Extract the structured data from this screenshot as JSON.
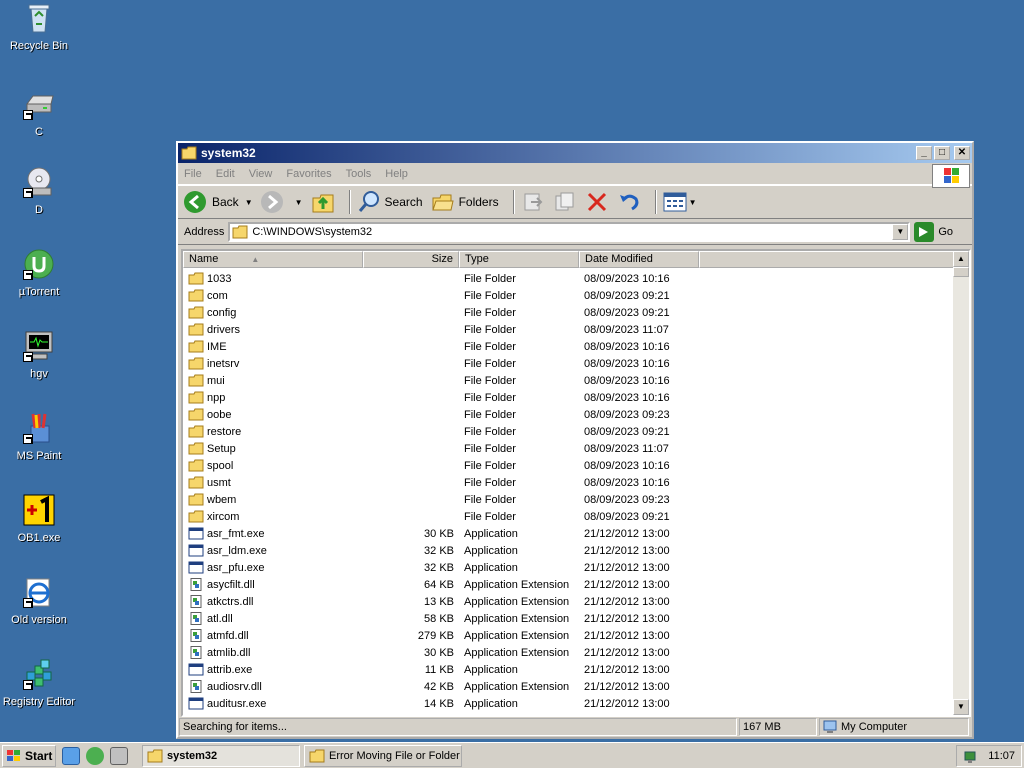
{
  "desktop": {
    "icons": [
      {
        "label": "Recycle Bin",
        "icon": "recycle-bin-icon"
      },
      {
        "label": "C",
        "icon": "drive-icon"
      },
      {
        "label": "D",
        "icon": "cd-drive-icon"
      },
      {
        "label": "µTorrent",
        "icon": "utorrent-icon"
      },
      {
        "label": "hgv",
        "icon": "monitor-icon"
      },
      {
        "label": "MS Paint",
        "icon": "paint-icon"
      },
      {
        "label": "OB1.exe",
        "icon": "ob1-icon"
      },
      {
        "label": "Old version",
        "icon": "internet-explorer-icon"
      },
      {
        "label": "Registry Editor",
        "icon": "registry-editor-icon"
      }
    ]
  },
  "window": {
    "title": "system32",
    "menu": [
      "File",
      "Edit",
      "View",
      "Favorites",
      "Tools",
      "Help"
    ],
    "toolbar": {
      "back_label": "Back",
      "search_label": "Search",
      "folders_label": "Folders"
    },
    "address": {
      "label": "Address",
      "value": "C:\\WINDOWS\\system32",
      "go_label": "Go"
    },
    "columns": {
      "name": "Name",
      "size": "Size",
      "type": "Type",
      "date": "Date Modified"
    },
    "files": [
      {
        "name": "1033",
        "size": "",
        "type": "File Folder",
        "date": "08/09/2023 10:16",
        "kind": "folder"
      },
      {
        "name": "com",
        "size": "",
        "type": "File Folder",
        "date": "08/09/2023 09:21",
        "kind": "folder"
      },
      {
        "name": "config",
        "size": "",
        "type": "File Folder",
        "date": "08/09/2023 09:21",
        "kind": "folder"
      },
      {
        "name": "drivers",
        "size": "",
        "type": "File Folder",
        "date": "08/09/2023 11:07",
        "kind": "folder"
      },
      {
        "name": "IME",
        "size": "",
        "type": "File Folder",
        "date": "08/09/2023 10:16",
        "kind": "folder"
      },
      {
        "name": "inetsrv",
        "size": "",
        "type": "File Folder",
        "date": "08/09/2023 10:16",
        "kind": "folder"
      },
      {
        "name": "mui",
        "size": "",
        "type": "File Folder",
        "date": "08/09/2023 10:16",
        "kind": "folder"
      },
      {
        "name": "npp",
        "size": "",
        "type": "File Folder",
        "date": "08/09/2023 10:16",
        "kind": "folder"
      },
      {
        "name": "oobe",
        "size": "",
        "type": "File Folder",
        "date": "08/09/2023 09:23",
        "kind": "folder"
      },
      {
        "name": "restore",
        "size": "",
        "type": "File Folder",
        "date": "08/09/2023 09:21",
        "kind": "folder"
      },
      {
        "name": "Setup",
        "size": "",
        "type": "File Folder",
        "date": "08/09/2023 11:07",
        "kind": "folder"
      },
      {
        "name": "spool",
        "size": "",
        "type": "File Folder",
        "date": "08/09/2023 10:16",
        "kind": "folder"
      },
      {
        "name": "usmt",
        "size": "",
        "type": "File Folder",
        "date": "08/09/2023 10:16",
        "kind": "folder"
      },
      {
        "name": "wbem",
        "size": "",
        "type": "File Folder",
        "date": "08/09/2023 09:23",
        "kind": "folder"
      },
      {
        "name": "xircom",
        "size": "",
        "type": "File Folder",
        "date": "08/09/2023 09:21",
        "kind": "folder"
      },
      {
        "name": "asr_fmt.exe",
        "size": "30 KB",
        "type": "Application",
        "date": "21/12/2012 13:00",
        "kind": "exe"
      },
      {
        "name": "asr_ldm.exe",
        "size": "32 KB",
        "type": "Application",
        "date": "21/12/2012 13:00",
        "kind": "exe"
      },
      {
        "name": "asr_pfu.exe",
        "size": "32 KB",
        "type": "Application",
        "date": "21/12/2012 13:00",
        "kind": "exe"
      },
      {
        "name": "asycfilt.dll",
        "size": "64 KB",
        "type": "Application Extension",
        "date": "21/12/2012 13:00",
        "kind": "dll"
      },
      {
        "name": "atkctrs.dll",
        "size": "13 KB",
        "type": "Application Extension",
        "date": "21/12/2012 13:00",
        "kind": "dll"
      },
      {
        "name": "atl.dll",
        "size": "58 KB",
        "type": "Application Extension",
        "date": "21/12/2012 13:00",
        "kind": "dll"
      },
      {
        "name": "atmfd.dll",
        "size": "279 KB",
        "type": "Application Extension",
        "date": "21/12/2012 13:00",
        "kind": "dll"
      },
      {
        "name": "atmlib.dll",
        "size": "30 KB",
        "type": "Application Extension",
        "date": "21/12/2012 13:00",
        "kind": "dll"
      },
      {
        "name": "attrib.exe",
        "size": "11 KB",
        "type": "Application",
        "date": "21/12/2012 13:00",
        "kind": "exe"
      },
      {
        "name": "audiosrv.dll",
        "size": "42 KB",
        "type": "Application Extension",
        "date": "21/12/2012 13:00",
        "kind": "dll"
      },
      {
        "name": "auditusr.exe",
        "size": "14 KB",
        "type": "Application",
        "date": "21/12/2012 13:00",
        "kind": "exe"
      }
    ],
    "status": {
      "message": "Searching for items...",
      "size": "167 MB",
      "zone": "My Computer"
    }
  },
  "taskbar": {
    "start_label": "Start",
    "tasks": [
      {
        "label": "system32",
        "active": true
      },
      {
        "label": "Error Moving File or Folder",
        "active": false
      }
    ],
    "clock": "11:07"
  },
  "colors": {
    "desktop": "#3a6ea5",
    "title_start": "#0a246a",
    "title_end": "#a6caf0",
    "face": "#d4d0c8"
  }
}
